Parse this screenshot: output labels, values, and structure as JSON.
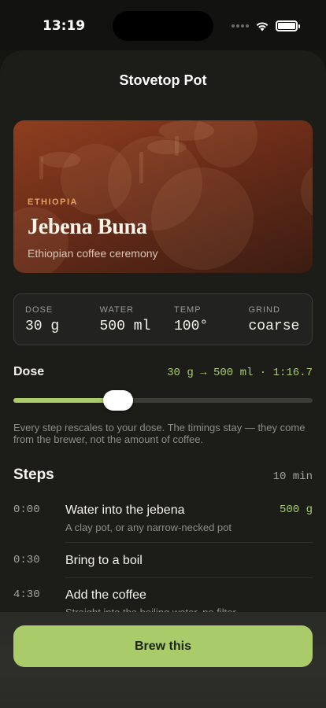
{
  "status": {
    "time": "13:19"
  },
  "sheet": {
    "title": "Stovetop Pot"
  },
  "hero": {
    "origin": "ETHIOPIA",
    "name": "Jebena Buna",
    "description": "Ethiopian coffee ceremony"
  },
  "params": [
    {
      "label": "DOSE",
      "value": "30 g"
    },
    {
      "label": "WATER",
      "value": "500 ml"
    },
    {
      "label": "TEMP",
      "value": "100°"
    },
    {
      "label": "GRIND",
      "value": "coarse"
    }
  ],
  "dose": {
    "label": "Dose",
    "ratio": "30 g → 500 ml · 1:16.7",
    "slider_level": 0.35,
    "note": "Every step rescales to your dose. The timings stay — they come from the brewer, not the amount of coffee."
  },
  "steps": {
    "title": "Steps",
    "total": "10 min",
    "items": [
      {
        "time": "0:00",
        "name": "Water into the jebena",
        "sub": "A clay pot, or any narrow-necked pot",
        "amount": "500 g"
      },
      {
        "time": "0:30",
        "name": "Bring to a boil",
        "sub": "",
        "amount": ""
      },
      {
        "time": "4:30",
        "name": "Add the coffee",
        "sub": "Straight into the boiling water, no filter",
        "amount": ""
      }
    ]
  },
  "cta": {
    "label": "Brew this"
  },
  "colors": {
    "accent": "#a9cb6a",
    "hero": "#8e3e1f",
    "origin": "#e8a060"
  }
}
